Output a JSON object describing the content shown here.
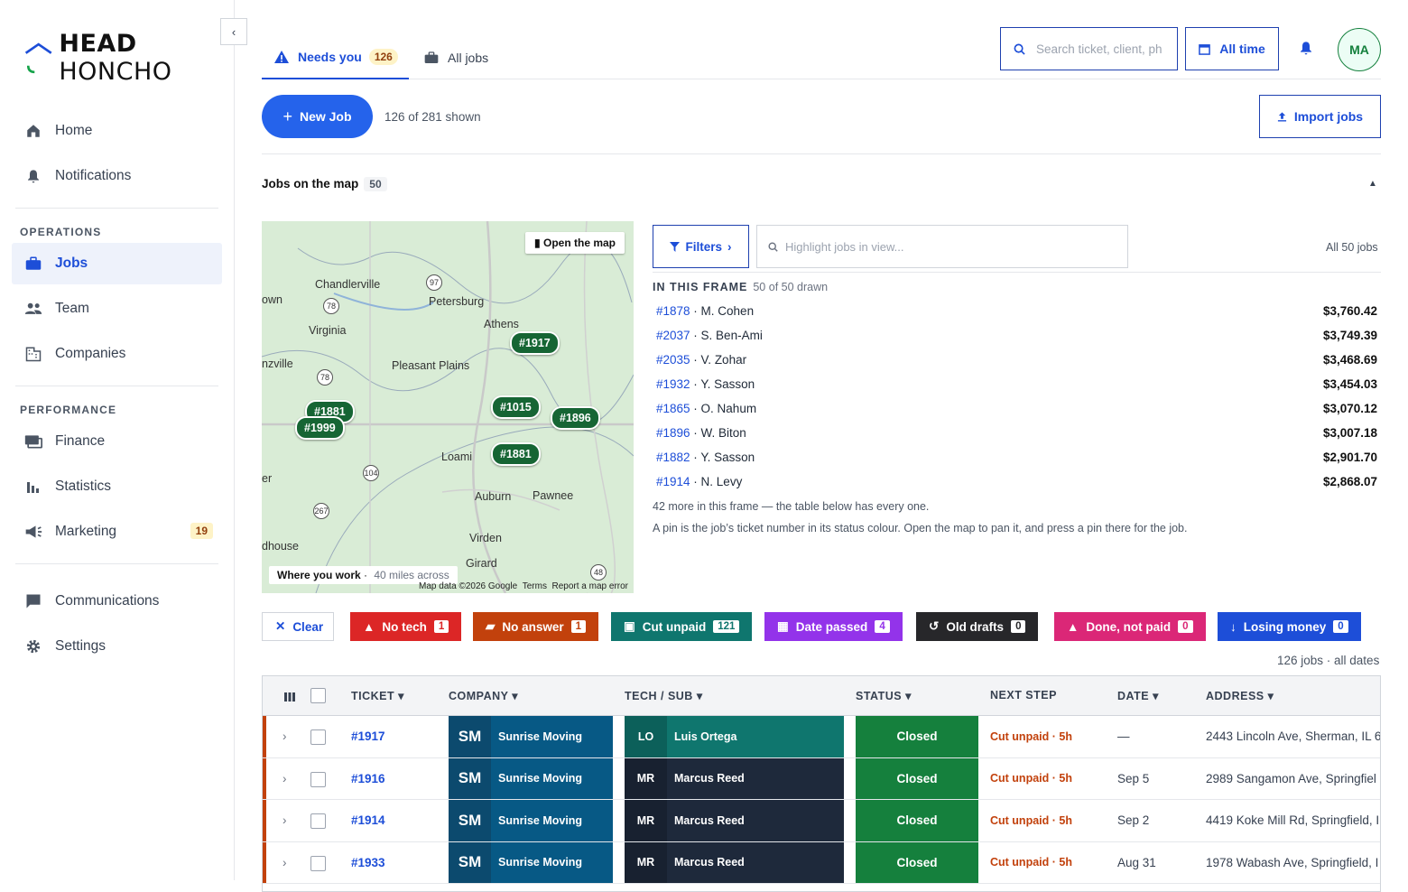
{
  "app": {
    "logo_bold": "HEAD",
    "logo_rest": " HONCHO"
  },
  "sidebar": {
    "top_items": [
      {
        "label": "Home",
        "icon": "home-icon"
      },
      {
        "label": "Notifications",
        "icon": "bell-icon"
      }
    ],
    "operations_heading": "OPERATIONS",
    "operations": [
      {
        "label": "Jobs",
        "icon": "briefcase-icon",
        "active": true
      },
      {
        "label": "Team",
        "icon": "people-icon"
      },
      {
        "label": "Companies",
        "icon": "building-icon"
      }
    ],
    "performance_heading": "PERFORMANCE",
    "performance": [
      {
        "label": "Finance",
        "icon": "finance-icon"
      },
      {
        "label": "Statistics",
        "icon": "bar-chart-icon"
      },
      {
        "label": "Marketing",
        "icon": "megaphone-icon",
        "badge": "19"
      }
    ],
    "bottom": [
      {
        "label": "Communications",
        "icon": "chat-icon"
      },
      {
        "label": "Settings",
        "icon": "gear-icon"
      }
    ]
  },
  "tabs": [
    {
      "label": "Needs you",
      "count": "126",
      "active": true
    },
    {
      "label": "All jobs"
    }
  ],
  "header": {
    "search_placeholder": "Search ticket, client, ph",
    "date_filter": "All time",
    "avatar": "MA"
  },
  "toolbar": {
    "new_job": "New Job",
    "shown": "126 of 281 shown",
    "import": "Import jobs"
  },
  "map_section": {
    "title": "Jobs on the map",
    "count": "50",
    "open_map": "Open the map",
    "where_title": "Where you work",
    "where_scale": "40 miles across",
    "footer": {
      "data": "Map data ©2026 Google",
      "terms": "Terms",
      "report": "Report a map error"
    },
    "towns": [
      "Chandlerville",
      "Petersburg",
      "Athens",
      "Virginia",
      "Pleasant Plains",
      "Loami",
      "Auburn",
      "Pawnee",
      "Virden",
      "Girard",
      "own",
      "nzville",
      "er",
      "dhouse"
    ],
    "pins": [
      "#1917",
      "#1015",
      "#1896",
      "#1999",
      "#1881"
    ]
  },
  "frame": {
    "filters": "Filters",
    "highlight_placeholder": "Highlight jobs in view...",
    "all_jobs": "All 50 jobs",
    "heading": "IN THIS FRAME",
    "drawn": "50 of 50 drawn",
    "rows": [
      {
        "ticket": "#1878",
        "name": "M. Cohen",
        "amount": "$3,760.42"
      },
      {
        "ticket": "#2037",
        "name": "S. Ben-Ami",
        "amount": "$3,749.39"
      },
      {
        "ticket": "#2035",
        "name": "V. Zohar",
        "amount": "$3,468.69"
      },
      {
        "ticket": "#1932",
        "name": "Y. Sasson",
        "amount": "$3,454.03"
      },
      {
        "ticket": "#1865",
        "name": "O. Nahum",
        "amount": "$3,070.12"
      },
      {
        "ticket": "#1896",
        "name": "W. Biton",
        "amount": "$3,007.18"
      },
      {
        "ticket": "#1882",
        "name": "Y. Sasson",
        "amount": "$2,901.70"
      },
      {
        "ticket": "#1914",
        "name": "N. Levy",
        "amount": "$2,868.07"
      }
    ],
    "more": "42 more in this frame — the table below has every one.",
    "hint": "A pin is the job’s ticket number in its status colour. Open the map to pan it, and press a pin there for the job."
  },
  "chips": {
    "clear": "Clear",
    "items": [
      {
        "label": "No tech",
        "count": "1",
        "color": "#dc2626"
      },
      {
        "label": "No answer",
        "count": "1",
        "color": "#c2410c"
      },
      {
        "label": "Cut unpaid",
        "count": "121",
        "color": "#0f766e"
      },
      {
        "label": "Date passed",
        "count": "4",
        "color": "#9333ea"
      },
      {
        "label": "Old drafts",
        "count": "0",
        "color": "#27272a"
      },
      {
        "label": "Done, not paid",
        "count": "0",
        "color": "#db2777"
      },
      {
        "label": "Losing money",
        "count": "0",
        "color": "#1d4ed8"
      }
    ],
    "summary": "126 jobs · all dates"
  },
  "table": {
    "headers": {
      "ticket": "TICKET",
      "company": "COMPANY",
      "tech": "TECH / SUB",
      "status": "STATUS",
      "next": "NEXT STEP",
      "date": "DATE",
      "address": "ADDRESS"
    },
    "rows": [
      {
        "ticket": "#1917",
        "co_abbr": "SM",
        "company": "Sunrise Moving",
        "tech_abbr": "LO",
        "tech": "Luis Ortega",
        "status": "Closed",
        "next": "Cut unpaid · 5h",
        "date": "—",
        "address": "2443 Lincoln Ave, Sherman, IL 6"
      },
      {
        "ticket": "#1916",
        "co_abbr": "SM",
        "company": "Sunrise Moving",
        "tech_abbr": "MR",
        "tech": "Marcus Reed",
        "status": "Closed",
        "next": "Cut unpaid · 5h",
        "date": "Sep 5",
        "address": "2989 Sangamon Ave, Springfiel"
      },
      {
        "ticket": "#1914",
        "co_abbr": "SM",
        "company": "Sunrise Moving",
        "tech_abbr": "MR",
        "tech": "Marcus Reed",
        "status": "Closed",
        "next": "Cut unpaid · 5h",
        "date": "Sep 2",
        "address": "4419 Koke Mill Rd, Springfield, I"
      },
      {
        "ticket": "#1933",
        "co_abbr": "SM",
        "company": "Sunrise Moving",
        "tech_abbr": "MR",
        "tech": "Marcus Reed",
        "status": "Closed",
        "next": "Cut unpaid · 5h",
        "date": "Aug 31",
        "address": "1978 Wabash Ave, Springfield, I"
      }
    ]
  }
}
